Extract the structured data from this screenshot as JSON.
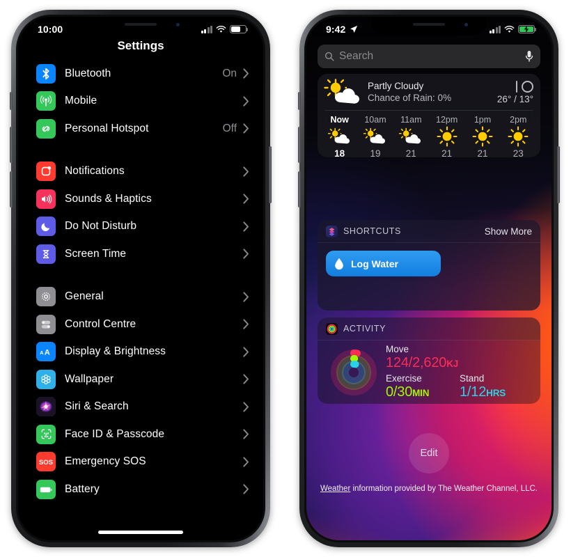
{
  "left_phone": {
    "status_bar": {
      "time": "10:00",
      "cellular_icon": "signal-bars-icon",
      "wifi_icon": "wifi-icon",
      "battery_icon": "battery-icon",
      "battery_charging": false
    },
    "nav_title": "Settings",
    "groups": [
      {
        "rows": [
          {
            "label": "Bluetooth",
            "value": "On",
            "icon": "bluetooth-icon",
            "icon_color": "#0a84ff"
          },
          {
            "label": "Mobile",
            "value": "",
            "icon": "cellular-antenna-icon",
            "icon_color": "#34c759"
          },
          {
            "label": "Personal Hotspot",
            "value": "Off",
            "icon": "hotspot-link-icon",
            "icon_color": "#34c759"
          }
        ]
      },
      {
        "rows": [
          {
            "label": "Notifications",
            "value": "",
            "icon": "notifications-badge-icon",
            "icon_color": "#ff3b30"
          },
          {
            "label": "Sounds & Haptics",
            "value": "",
            "icon": "speaker-waves-icon",
            "icon_color": "#f4325c"
          },
          {
            "label": "Do Not Disturb",
            "value": "",
            "icon": "moon-icon",
            "icon_color": "#5e5ce6"
          },
          {
            "label": "Screen Time",
            "value": "",
            "icon": "hourglass-icon",
            "icon_color": "#5e5ce6"
          }
        ]
      },
      {
        "rows": [
          {
            "label": "General",
            "value": "",
            "icon": "gear-icon",
            "icon_color": "#8e8e93"
          },
          {
            "label": "Control Centre",
            "value": "",
            "icon": "toggles-icon",
            "icon_color": "#8e8e93"
          },
          {
            "label": "Display & Brightness",
            "value": "",
            "icon": "text-size-icon",
            "icon_color": "#0a84ff"
          },
          {
            "label": "Wallpaper",
            "value": "",
            "icon": "flower-icon",
            "icon_color": "#31b0e8"
          },
          {
            "label": "Siri & Search",
            "value": "",
            "icon": "siri-icon",
            "icon_color": "#2a1a3a"
          },
          {
            "label": "Face ID & Passcode",
            "value": "",
            "icon": "face-id-icon",
            "icon_color": "#34c759"
          },
          {
            "label": "Emergency SOS",
            "value": "",
            "icon": "sos-icon",
            "icon_color": "#ff3b30"
          },
          {
            "label": "Battery",
            "value": "",
            "icon": "battery-green-icon",
            "icon_color": "#34c759"
          }
        ]
      }
    ]
  },
  "right_phone": {
    "status_bar": {
      "time": "9:42",
      "location_icon": "location-arrow-icon",
      "cellular_icon": "signal-bars-icon",
      "wifi_icon": "wifi-icon",
      "battery_icon": "battery-charging-icon",
      "battery_charging": true
    },
    "search": {
      "placeholder": "Search",
      "search_icon": "search-icon",
      "mic_icon": "microphone-icon"
    },
    "weather_widget": {
      "icon": "sun-behind-cloud-icon",
      "condition": "Partly Cloudy",
      "rain": "Chance of Rain: 0%",
      "high_low": "26° / 13°",
      "hours": [
        {
          "time": "Now",
          "icon": "sun-behind-cloud-icon",
          "temp": "18",
          "is_now": true
        },
        {
          "time": "10am",
          "icon": "sun-behind-cloud-icon",
          "temp": "19",
          "is_now": false
        },
        {
          "time": "11am",
          "icon": "sun-behind-cloud-icon",
          "temp": "21",
          "is_now": false
        },
        {
          "time": "12pm",
          "icon": "sun-icon",
          "temp": "21",
          "is_now": false
        },
        {
          "time": "1pm",
          "icon": "sun-icon",
          "temp": "21",
          "is_now": false
        },
        {
          "time": "2pm",
          "icon": "sun-icon",
          "temp": "23",
          "is_now": false
        }
      ]
    },
    "shortcuts_widget": {
      "badge_icon": "shortcuts-app-icon",
      "title": "SHORTCUTS",
      "action": "Show More",
      "tiles": [
        {
          "label": "Log Water",
          "icon": "water-drop-icon",
          "color": "#1b8ae8"
        }
      ]
    },
    "activity_widget": {
      "badge_icon": "activity-rings-icon",
      "title": "ACTIVITY",
      "rings_icon": "activity-rings-large-icon",
      "move_label": "Move",
      "move_value": "124/2,620",
      "move_unit": "KJ",
      "move_color": "#fa2d55",
      "exercise_label": "Exercise",
      "exercise_value": "0/30",
      "exercise_unit": "MIN",
      "exercise_color": "#a4f700",
      "stand_label": "Stand",
      "stand_value": "1/12",
      "stand_unit": "HRS",
      "stand_color": "#2ad2e8"
    },
    "edit_button": "Edit",
    "footer": {
      "link": "Weather",
      "rest": " information provided by The Weather Channel, LLC."
    }
  }
}
